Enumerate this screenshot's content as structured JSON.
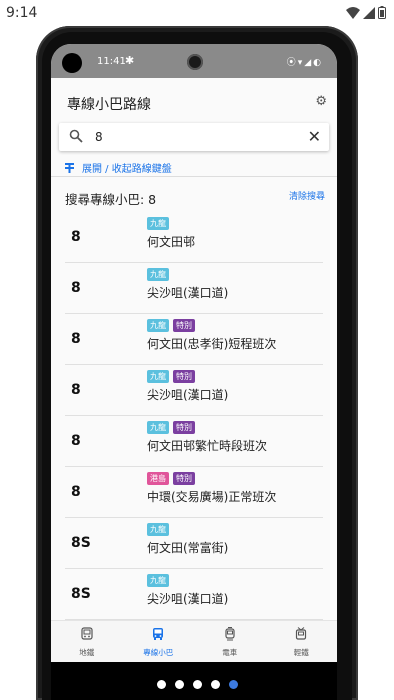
{
  "host": {
    "time": "9:14"
  },
  "device": {
    "time": "11:41"
  },
  "header": {
    "title": "專線小巴路線"
  },
  "search": {
    "value": "8"
  },
  "expand_label": "展開 / 收起路線鍵盤",
  "results": {
    "title": "搜尋專線小巴: 8",
    "clear_label": "清除搜尋"
  },
  "badge_colors": {
    "九龍": "#5bc0de",
    "港島": "#e0559a",
    "特別": "#7b3fa0"
  },
  "routes": [
    {
      "route": "8",
      "badges": [
        "九龍"
      ],
      "dest": "何文田邨"
    },
    {
      "route": "8",
      "badges": [
        "九龍"
      ],
      "dest": "尖沙咀(漢口道)"
    },
    {
      "route": "8",
      "badges": [
        "九龍",
        "特別"
      ],
      "dest": "何文田(忠孝街)短程班次"
    },
    {
      "route": "8",
      "badges": [
        "九龍",
        "特別"
      ],
      "dest": "尖沙咀(漢口道)"
    },
    {
      "route": "8",
      "badges": [
        "九龍",
        "特別"
      ],
      "dest": "何文田邨繁忙時段班次"
    },
    {
      "route": "8",
      "badges": [
        "港島",
        "特別"
      ],
      "dest": "中環(交易廣場)正常班次"
    },
    {
      "route": "8S",
      "badges": [
        "九龍"
      ],
      "dest": "何文田(常富街)"
    },
    {
      "route": "8S",
      "badges": [
        "九龍"
      ],
      "dest": "尖沙咀(漢口道)"
    }
  ],
  "nav": [
    {
      "label": "地鐵",
      "icon": "metro-icon",
      "active": false
    },
    {
      "label": "專線小巴",
      "icon": "minibus-icon",
      "active": true
    },
    {
      "label": "電車",
      "icon": "tram-icon",
      "active": false
    },
    {
      "label": "輕鐵",
      "icon": "light-rail-icon",
      "active": false
    }
  ]
}
